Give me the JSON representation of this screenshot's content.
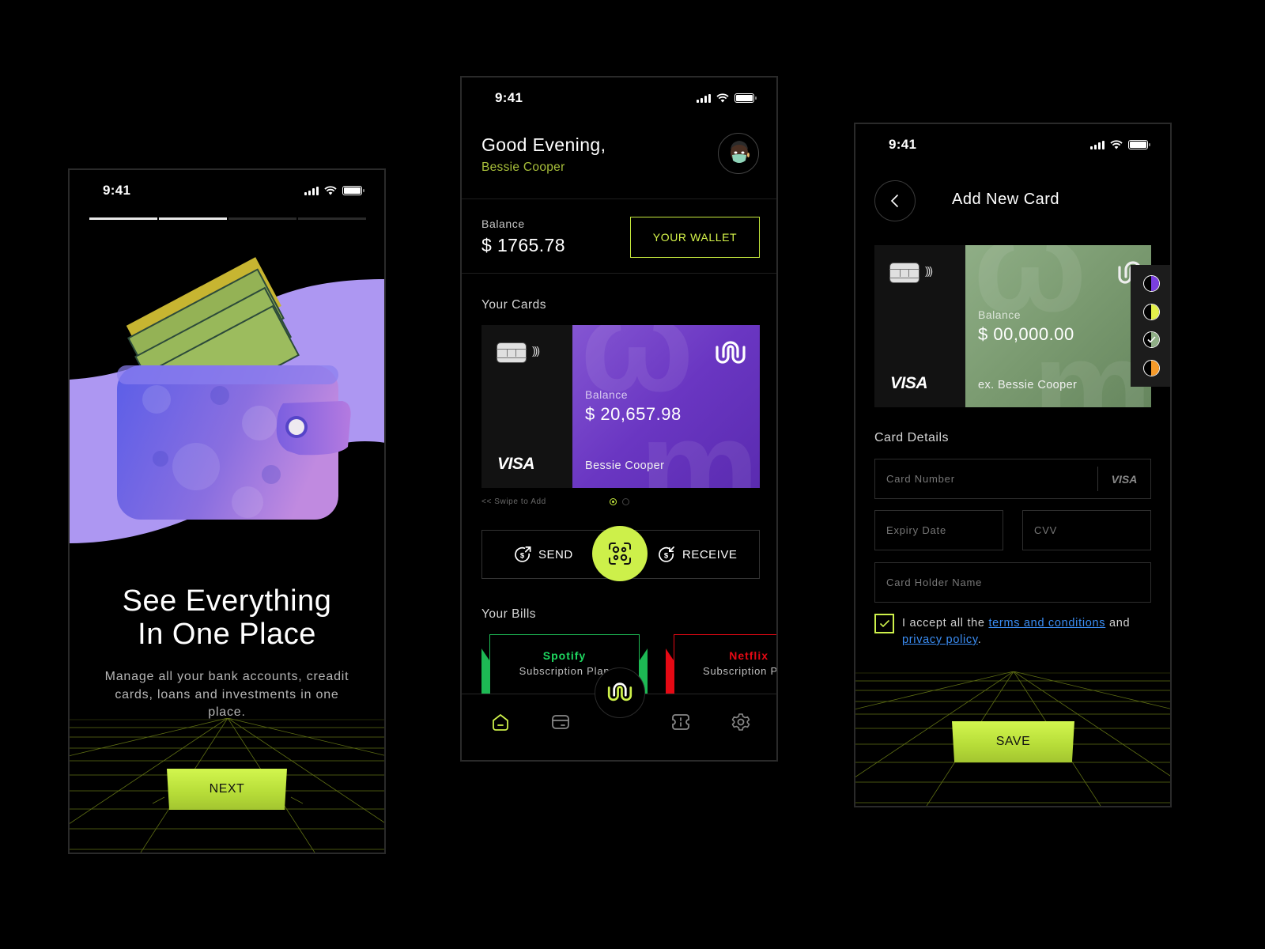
{
  "status_bar": {
    "time": "9:41"
  },
  "onboarding": {
    "progress": {
      "total_steps": 4,
      "completed_steps": 2
    },
    "headline_line1": "See Everything",
    "headline_line2": "In One Place",
    "description": "Manage all your bank accounts, creadit cards, loans and investments in one place.",
    "next_label": "NEXT"
  },
  "home": {
    "greeting": "Good Evening,",
    "user_name": "Bessie Cooper",
    "balance_label": "Balance",
    "balance_value": "$ 1765.78",
    "wallet_button": "YOUR WALLET",
    "cards_section": "Your Cards",
    "card": {
      "network": "VISA",
      "balance_label": "Balance",
      "balance_value": "$ 20,657.98",
      "holder": "Bessie Cooper",
      "color": "#7443c8"
    },
    "swipe_hint": "<< Swipe to Add",
    "card_pager": {
      "total": 2,
      "active": 1
    },
    "send_label": "SEND",
    "receive_label": "RECEIVE",
    "bills_section": "Your Bills",
    "bills": [
      {
        "name": "Spotify",
        "plan": "Subscription Plan",
        "color": "#1db954"
      },
      {
        "name": "Netflix",
        "plan": "Subscription Plan",
        "color": "#e50914"
      }
    ],
    "tabbar": [
      {
        "name": "home",
        "icon": "home-icon",
        "active": true
      },
      {
        "name": "cards",
        "icon": "card-icon",
        "active": false
      },
      {
        "name": "center",
        "icon": "brand-logo-icon",
        "active": false
      },
      {
        "name": "vouchers",
        "icon": "ticket-icon",
        "active": false
      },
      {
        "name": "settings",
        "icon": "gear-icon",
        "active": false
      }
    ]
  },
  "add_card": {
    "title": "Add New Card",
    "card_preview": {
      "network": "VISA",
      "balance_label": "Balance",
      "balance_value": "$ 00,000.00",
      "holder": "ex. Bessie Cooper",
      "color": "#7f9f76"
    },
    "color_options": [
      {
        "color": "#7a3fe0",
        "selected": false
      },
      {
        "color": "#e3f04a",
        "selected": false
      },
      {
        "color": "#8fae86",
        "selected": true
      },
      {
        "color": "#f59a2a",
        "selected": false
      }
    ],
    "details_label": "Card Details",
    "fields": {
      "card_number": {
        "placeholder": "Card Number",
        "value": "",
        "brand": "VISA"
      },
      "expiry": {
        "placeholder": "Expiry Date",
        "value": ""
      },
      "cvv": {
        "placeholder": "CVV",
        "value": ""
      },
      "holder": {
        "placeholder": "Card Holder Name",
        "value": ""
      }
    },
    "terms": {
      "checked": true,
      "prefix": "I accept all the ",
      "terms_link": "terms and conditions",
      "middle": " and ",
      "privacy_link": "privacy policy",
      "suffix": "."
    },
    "save_label": "SAVE"
  },
  "colors": {
    "accent": "#cdf04a",
    "background": "#000000",
    "link": "#3b8ef5"
  }
}
